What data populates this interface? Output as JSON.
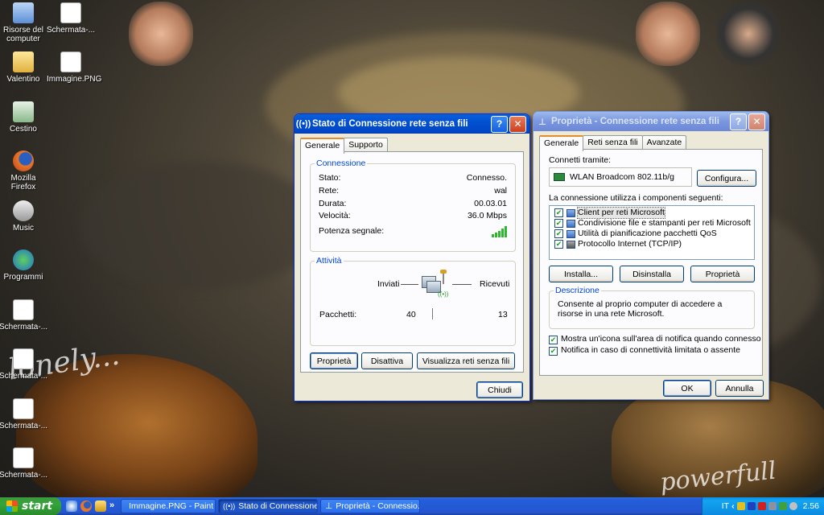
{
  "desktop": {
    "icons": [
      {
        "label": "Risorse del computer"
      },
      {
        "label": "Schermata-..."
      },
      {
        "label": "Valentino"
      },
      {
        "label": "Immagine.PNG"
      },
      {
        "label": "Cestino"
      },
      {
        "label": "Mozilla Firefox"
      },
      {
        "label": "Music"
      },
      {
        "label": "Programmi"
      },
      {
        "label": "Schermata-..."
      },
      {
        "label": "Schermata-..."
      },
      {
        "label": "Schermata-..."
      },
      {
        "label": "Schermata-..."
      }
    ],
    "wallpaper_text_left": "lonely...",
    "wallpaper_text_right": "powerfull"
  },
  "status_window": {
    "title": "Stato di Connessione rete senza fili",
    "tabs": [
      "Generale",
      "Supporto"
    ],
    "connection": {
      "legend": "Connessione",
      "rows": [
        {
          "label": "Stato:",
          "value": "Connesso."
        },
        {
          "label": "Rete:",
          "value": "wal"
        },
        {
          "label": "Durata:",
          "value": "00.03.01"
        },
        {
          "label": "Velocità:",
          "value": "36.0 Mbps"
        }
      ],
      "signal_label": "Potenza segnale:",
      "signal_bars": 5
    },
    "activity": {
      "legend": "Attività",
      "sent_label": "Inviati",
      "received_label": "Ricevuti",
      "packets_label": "Pacchetti:",
      "packets_sent": "40",
      "packets_received": "13"
    },
    "buttons": {
      "properties": "Proprietà",
      "disable": "Disattiva",
      "view_networks": "Visualizza reti senza fili",
      "close": "Chiudi"
    }
  },
  "props_window": {
    "title": "Proprietà - Connessione rete senza fili",
    "tabs": [
      "Generale",
      "Reti senza fili",
      "Avanzate"
    ],
    "connect_using_label": "Connetti tramite:",
    "adapter": "WLAN Broadcom 802.11b/g",
    "configure_button": "Configura...",
    "components_label": "La connessione utilizza i componenti seguenti:",
    "components": [
      {
        "label": "Client per reti Microsoft",
        "checked": true
      },
      {
        "label": "Condivisione file e stampanti per reti Microsoft",
        "checked": true
      },
      {
        "label": "Utilità di pianificazione pacchetti QoS",
        "checked": true
      },
      {
        "label": "Protocollo Internet (TCP/IP)",
        "checked": true
      }
    ],
    "buttons": {
      "install": "Installa...",
      "uninstall": "Disinstalla",
      "properties": "Proprietà",
      "ok": "OK",
      "cancel": "Annulla"
    },
    "description": {
      "legend": "Descrizione",
      "text": "Consente al proprio computer di accedere a risorse in una rete Microsoft."
    },
    "options": [
      {
        "label": "Mostra un'icona sull'area di notifica quando connesso",
        "checked": true
      },
      {
        "label": "Notifica in caso di connettività limitata o assente",
        "checked": true
      }
    ]
  },
  "taskbar": {
    "start_label": "start",
    "overflow": "»",
    "items": [
      {
        "label": "Immagine.PNG - Paint"
      },
      {
        "label": "Stato di Connessione ..."
      },
      {
        "label": "Proprietà - Connessio..."
      }
    ],
    "lang": "IT",
    "clock": "2.56"
  }
}
